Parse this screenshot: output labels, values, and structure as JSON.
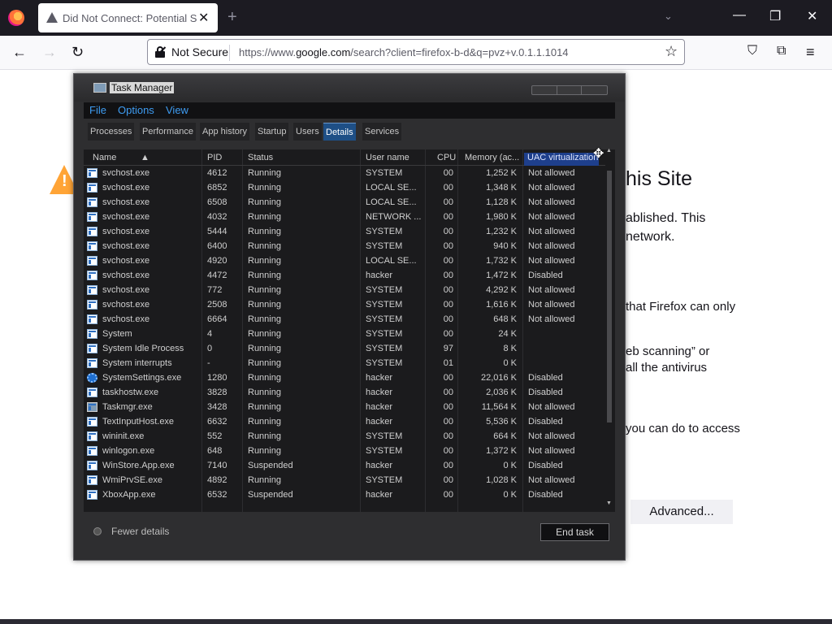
{
  "browser": {
    "tab_title": "Did Not Connect: Potential Security Issue",
    "not_secure_label": "Not Secure",
    "url_prefix": "https://www.",
    "url_domain": "google.com",
    "url_rest": "/search?client=firefox-b-d&q=pvz+v.0.1.1.1014"
  },
  "page": {
    "heading_partial": "his Site",
    "line1": "ablished. This",
    "line2": "network.",
    "line3": "that Firefox can only",
    "line4": "eb scanning” or",
    "line5": "all the antivirus",
    "line6": "you can do to access",
    "advanced_label": "Advanced..."
  },
  "taskmanager": {
    "title": "Task Manager",
    "menu": [
      "File",
      "Options",
      "View"
    ],
    "tabs": [
      "Processes",
      "Performance",
      "App history",
      "Startup",
      "Users",
      "Details",
      "Services"
    ],
    "active_tab": "Details",
    "columns": [
      "Name",
      "PID",
      "Status",
      "User name",
      "CPU",
      "Memory (ac...",
      "UAC virtualization"
    ],
    "rows": [
      {
        "name": "svchost.exe",
        "pid": "4612",
        "status": "Running",
        "user": "SYSTEM",
        "cpu": "00",
        "mem": "1,252 K",
        "uac": "Not allowed",
        "icon": "process-icon"
      },
      {
        "name": "svchost.exe",
        "pid": "6852",
        "status": "Running",
        "user": "LOCAL SE...",
        "cpu": "00",
        "mem": "1,348 K",
        "uac": "Not allowed",
        "icon": "process-icon"
      },
      {
        "name": "svchost.exe",
        "pid": "6508",
        "status": "Running",
        "user": "LOCAL SE...",
        "cpu": "00",
        "mem": "1,128 K",
        "uac": "Not allowed",
        "icon": "process-icon"
      },
      {
        "name": "svchost.exe",
        "pid": "4032",
        "status": "Running",
        "user": "NETWORK ...",
        "cpu": "00",
        "mem": "1,980 K",
        "uac": "Not allowed",
        "icon": "process-icon"
      },
      {
        "name": "svchost.exe",
        "pid": "5444",
        "status": "Running",
        "user": "SYSTEM",
        "cpu": "00",
        "mem": "1,232 K",
        "uac": "Not allowed",
        "icon": "process-icon"
      },
      {
        "name": "svchost.exe",
        "pid": "6400",
        "status": "Running",
        "user": "SYSTEM",
        "cpu": "00",
        "mem": "940 K",
        "uac": "Not allowed",
        "icon": "process-icon"
      },
      {
        "name": "svchost.exe",
        "pid": "4920",
        "status": "Running",
        "user": "LOCAL SE...",
        "cpu": "00",
        "mem": "1,732 K",
        "uac": "Not allowed",
        "icon": "process-icon"
      },
      {
        "name": "svchost.exe",
        "pid": "4472",
        "status": "Running",
        "user": "hacker",
        "cpu": "00",
        "mem": "1,472 K",
        "uac": "Disabled",
        "icon": "process-icon"
      },
      {
        "name": "svchost.exe",
        "pid": "772",
        "status": "Running",
        "user": "SYSTEM",
        "cpu": "00",
        "mem": "4,292 K",
        "uac": "Not allowed",
        "icon": "process-icon"
      },
      {
        "name": "svchost.exe",
        "pid": "2508",
        "status": "Running",
        "user": "SYSTEM",
        "cpu": "00",
        "mem": "1,616 K",
        "uac": "Not allowed",
        "icon": "process-icon"
      },
      {
        "name": "svchost.exe",
        "pid": "6664",
        "status": "Running",
        "user": "SYSTEM",
        "cpu": "00",
        "mem": "648 K",
        "uac": "Not allowed",
        "icon": "process-icon"
      },
      {
        "name": "System",
        "pid": "4",
        "status": "Running",
        "user": "SYSTEM",
        "cpu": "00",
        "mem": "24 K",
        "uac": "",
        "icon": "process-icon"
      },
      {
        "name": "System Idle Process",
        "pid": "0",
        "status": "Running",
        "user": "SYSTEM",
        "cpu": "97",
        "mem": "8 K",
        "uac": "",
        "icon": "process-icon"
      },
      {
        "name": "System interrupts",
        "pid": "-",
        "status": "Running",
        "user": "SYSTEM",
        "cpu": "01",
        "mem": "0 K",
        "uac": "",
        "icon": "process-icon"
      },
      {
        "name": "SystemSettings.exe",
        "pid": "1280",
        "status": "Running",
        "user": "hacker",
        "cpu": "00",
        "mem": "22,016 K",
        "uac": "Disabled",
        "icon": "gear-icon"
      },
      {
        "name": "taskhostw.exe",
        "pid": "3828",
        "status": "Running",
        "user": "hacker",
        "cpu": "00",
        "mem": "2,036 K",
        "uac": "Disabled",
        "icon": "process-icon"
      },
      {
        "name": "Taskmgr.exe",
        "pid": "3428",
        "status": "Running",
        "user": "hacker",
        "cpu": "00",
        "mem": "11,564 K",
        "uac": "Not allowed",
        "icon": "taskmgr-icon"
      },
      {
        "name": "TextInputHost.exe",
        "pid": "6632",
        "status": "Running",
        "user": "hacker",
        "cpu": "00",
        "mem": "5,536 K",
        "uac": "Disabled",
        "icon": "process-icon"
      },
      {
        "name": "wininit.exe",
        "pid": "552",
        "status": "Running",
        "user": "SYSTEM",
        "cpu": "00",
        "mem": "664 K",
        "uac": "Not allowed",
        "icon": "process-icon"
      },
      {
        "name": "winlogon.exe",
        "pid": "648",
        "status": "Running",
        "user": "SYSTEM",
        "cpu": "00",
        "mem": "1,372 K",
        "uac": "Not allowed",
        "icon": "process-icon"
      },
      {
        "name": "WinStore.App.exe",
        "pid": "7140",
        "status": "Suspended",
        "user": "hacker",
        "cpu": "00",
        "mem": "0 K",
        "uac": "Disabled",
        "icon": "process-icon"
      },
      {
        "name": "WmiPrvSE.exe",
        "pid": "4892",
        "status": "Running",
        "user": "SYSTEM",
        "cpu": "00",
        "mem": "1,028 K",
        "uac": "Not allowed",
        "icon": "process-icon"
      },
      {
        "name": "XboxApp.exe",
        "pid": "6532",
        "status": "Suspended",
        "user": "hacker",
        "cpu": "00",
        "mem": "0 K",
        "uac": "Disabled",
        "icon": "process-icon"
      }
    ],
    "fewer_details_label": "Fewer details",
    "end_task_label": "End task"
  }
}
